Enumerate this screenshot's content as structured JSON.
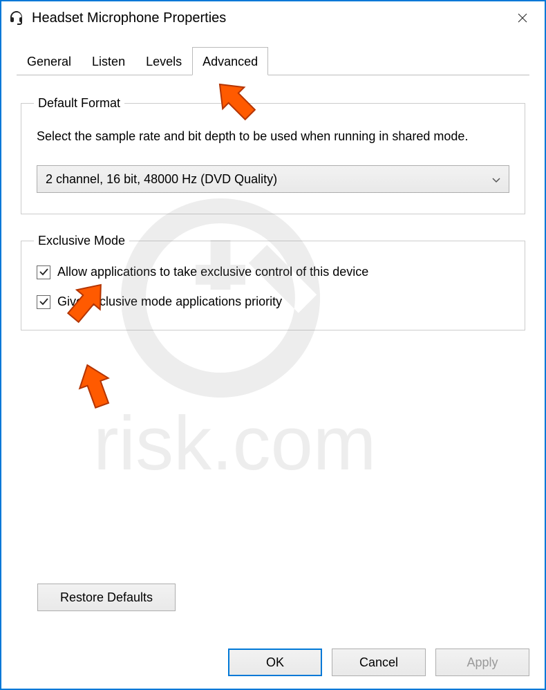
{
  "title": "Headset Microphone Properties",
  "tabs": {
    "general": "General",
    "listen": "Listen",
    "levels": "Levels",
    "advanced": "Advanced"
  },
  "defaultFormat": {
    "legend": "Default Format",
    "description": "Select the sample rate and bit depth to be used when running in shared mode.",
    "selected": "2 channel, 16 bit, 48000 Hz (DVD Quality)"
  },
  "exclusiveMode": {
    "legend": "Exclusive Mode",
    "allowExclusive": {
      "label": "Allow applications to take exclusive control of this device",
      "checked": true
    },
    "priority": {
      "label": "Give exclusive mode applications priority",
      "checked": true
    }
  },
  "buttons": {
    "restoreDefaults": "Restore Defaults",
    "ok": "OK",
    "cancel": "Cancel",
    "apply": "Apply"
  },
  "watermarkText": "risk.com"
}
